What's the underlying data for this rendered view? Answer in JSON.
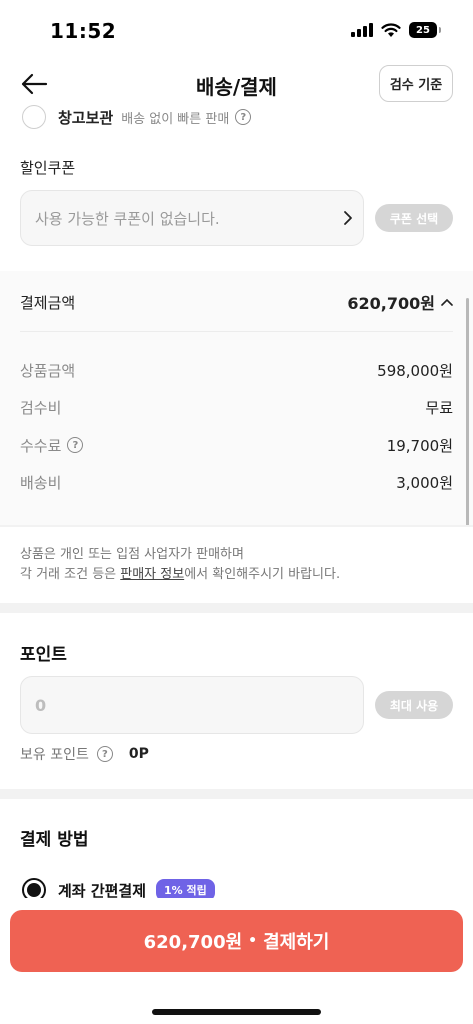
{
  "status_bar": {
    "time": "11:52",
    "battery_level": "25",
    "icons": [
      "cellular-signal-icon",
      "wifi-icon",
      "battery-icon"
    ]
  },
  "nav": {
    "title": "배송/결제",
    "criteria_button": "검수 기준",
    "back_icon": "arrow-left-icon"
  },
  "storage_option": {
    "label": "창고보관",
    "description": "배송 없이 빠른 판매",
    "help_icon": "?"
  },
  "coupon": {
    "title": "할인쿠폰",
    "placeholder": "사용 가능한 쿠폰이 없습니다.",
    "select_button": "쿠폰 선택"
  },
  "payment_summary": {
    "label": "결제금액",
    "total": "620,700원",
    "rows": [
      {
        "label": "상품금액",
        "value": "598,000원"
      },
      {
        "label": "검수비",
        "value": "무료"
      },
      {
        "label": "수수료",
        "value": "19,700원",
        "help": "?"
      },
      {
        "label": "배송비",
        "value": "3,000원"
      }
    ]
  },
  "notice": {
    "line1": "상품은 개인 또는 입점 사업자가 판매하며",
    "line2_prefix": "각 거래 조건 등은 ",
    "line2_link": "판매자 정보",
    "line2_suffix": "에서 확인해주시기 바랍니다."
  },
  "points": {
    "title": "포인트",
    "input_value": "0",
    "max_button": "최대 사용",
    "owned_label": "보유 포인트",
    "owned_help": "?",
    "owned_value": "0P"
  },
  "payment_method": {
    "title": "결제 방법",
    "option_label": "계좌 간편결제",
    "badge": "1% 적립"
  },
  "checkout": {
    "amount": "620,700원",
    "separator": "•",
    "action": "결제하기"
  },
  "colors": {
    "accent": "#ef6253",
    "badge": "#6f63e6",
    "disabled_button": "#d6d6d6"
  }
}
